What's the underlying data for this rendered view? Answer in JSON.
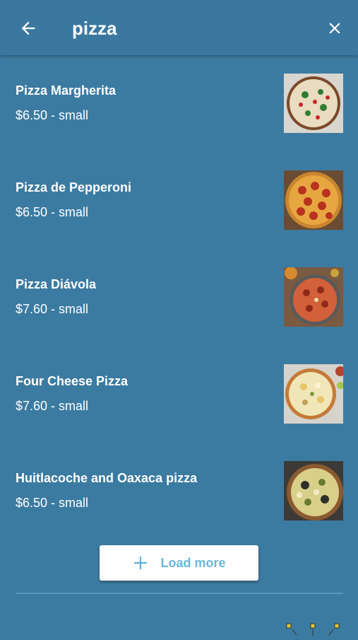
{
  "header": {
    "search_query": "pizza",
    "back_icon": "arrow-left-icon",
    "close_icon": "close-icon"
  },
  "results": [
    {
      "name": "Pizza Margherita",
      "price": "$6.50 - small"
    },
    {
      "name": "Pizza de Pepperoni",
      "price": "$6.50 - small"
    },
    {
      "name": "Pizza Diávola",
      "price": "$7.60 - small"
    },
    {
      "name": "Four Cheese Pizza",
      "price": "$7.60 - small"
    },
    {
      "name": "Huitlacoche and Oaxaca pizza",
      "price": "$6.50 - small"
    }
  ],
  "load_more": {
    "label": "Load more",
    "icon": "plus-icon"
  },
  "colors": {
    "background": "#3c7ba1",
    "accent": "#6ab7dc"
  }
}
